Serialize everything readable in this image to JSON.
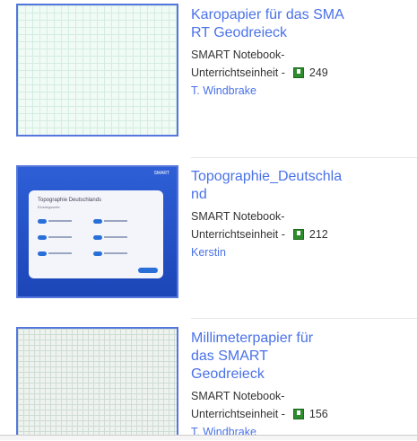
{
  "items": [
    {
      "title": "Karopapier für das SMART Geodreieck",
      "type_line1": "SMART Notebook-",
      "type_line2": "Unterrichtseinheit",
      "separator": "-",
      "downloads": "249",
      "author": "T. Windbrake",
      "download_icon": "download-icon"
    },
    {
      "title": "Topographie_Deutschland",
      "type_line1": "SMART Notebook-",
      "type_line2": "Unterrichtseinheit",
      "separator": "-",
      "downloads": "212",
      "author": "Kerstin",
      "download_icon": "download-icon",
      "thumb": {
        "logo": "SMART",
        "slide_title": "Topographie Deutschlands",
        "slide_subtitle": "Einstiegsseite"
      }
    },
    {
      "title": "Millimeterpapier für das SMART Geodreieck",
      "type_line1": "SMART Notebook-",
      "type_line2": "Unterrichtseinheit",
      "separator": "-",
      "downloads": "156",
      "author": "T. Windbrake",
      "download_icon": "download-icon"
    }
  ],
  "colors": {
    "link": "#4a72e8",
    "thumb_border": "#5577dd",
    "download_green": "#2e8b2e"
  }
}
